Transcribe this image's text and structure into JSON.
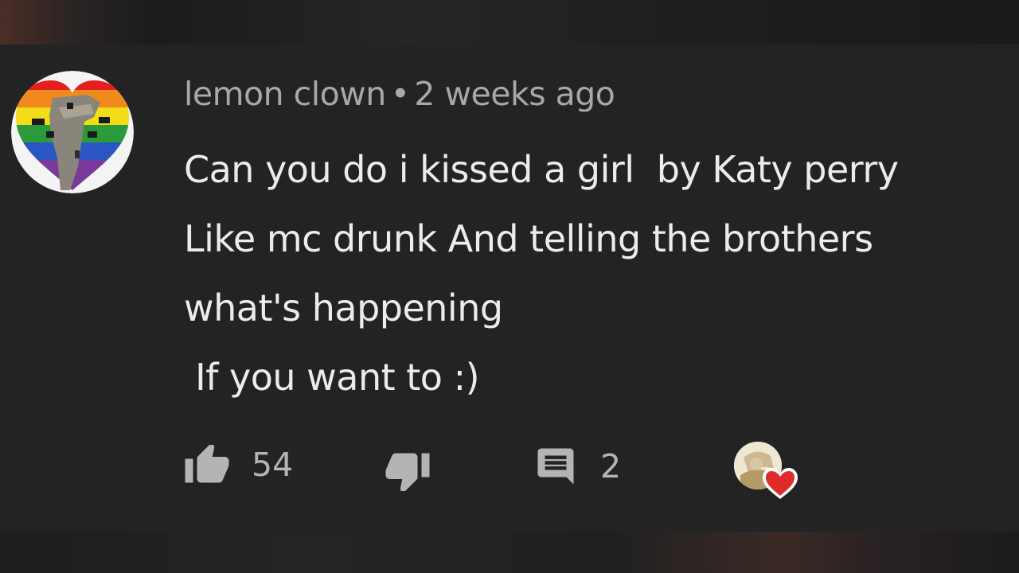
{
  "comment": {
    "author": "lemon clown",
    "separator": "•",
    "timestamp": "2 weeks ago",
    "lines": [
      "Can you do i kissed a girl  by Katy perry",
      "Like mc drunk And telling the brothers",
      "what's happening",
      " If you want to :)"
    ]
  },
  "actions": {
    "like_count": "54",
    "reply_count": "2"
  },
  "icons": {
    "like": "thumbs-up-icon",
    "dislike": "thumbs-down-icon",
    "reply": "comment-icon",
    "heart": "heart-icon"
  },
  "colors": {
    "background": "#232323",
    "meta_text": "#a8a8a8",
    "body_text": "#ececec",
    "icon": "#b4b4b4",
    "heart": "#e02b2b"
  }
}
